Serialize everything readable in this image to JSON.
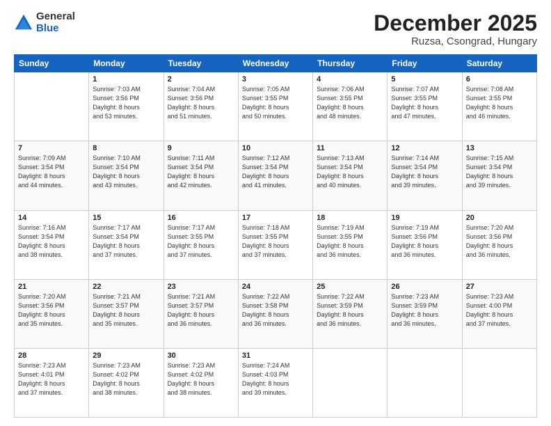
{
  "header": {
    "logo_general": "General",
    "logo_blue": "Blue",
    "title": "December 2025",
    "location": "Ruzsa, Csongrad, Hungary"
  },
  "weekdays": [
    "Sunday",
    "Monday",
    "Tuesday",
    "Wednesday",
    "Thursday",
    "Friday",
    "Saturday"
  ],
  "weeks": [
    [
      {
        "day": "",
        "info": ""
      },
      {
        "day": "1",
        "info": "Sunrise: 7:03 AM\nSunset: 3:56 PM\nDaylight: 8 hours\nand 53 minutes."
      },
      {
        "day": "2",
        "info": "Sunrise: 7:04 AM\nSunset: 3:56 PM\nDaylight: 8 hours\nand 51 minutes."
      },
      {
        "day": "3",
        "info": "Sunrise: 7:05 AM\nSunset: 3:55 PM\nDaylight: 8 hours\nand 50 minutes."
      },
      {
        "day": "4",
        "info": "Sunrise: 7:06 AM\nSunset: 3:55 PM\nDaylight: 8 hours\nand 48 minutes."
      },
      {
        "day": "5",
        "info": "Sunrise: 7:07 AM\nSunset: 3:55 PM\nDaylight: 8 hours\nand 47 minutes."
      },
      {
        "day": "6",
        "info": "Sunrise: 7:08 AM\nSunset: 3:55 PM\nDaylight: 8 hours\nand 46 minutes."
      }
    ],
    [
      {
        "day": "7",
        "info": "Sunrise: 7:09 AM\nSunset: 3:54 PM\nDaylight: 8 hours\nand 44 minutes."
      },
      {
        "day": "8",
        "info": "Sunrise: 7:10 AM\nSunset: 3:54 PM\nDaylight: 8 hours\nand 43 minutes."
      },
      {
        "day": "9",
        "info": "Sunrise: 7:11 AM\nSunset: 3:54 PM\nDaylight: 8 hours\nand 42 minutes."
      },
      {
        "day": "10",
        "info": "Sunrise: 7:12 AM\nSunset: 3:54 PM\nDaylight: 8 hours\nand 41 minutes."
      },
      {
        "day": "11",
        "info": "Sunrise: 7:13 AM\nSunset: 3:54 PM\nDaylight: 8 hours\nand 40 minutes."
      },
      {
        "day": "12",
        "info": "Sunrise: 7:14 AM\nSunset: 3:54 PM\nDaylight: 8 hours\nand 39 minutes."
      },
      {
        "day": "13",
        "info": "Sunrise: 7:15 AM\nSunset: 3:54 PM\nDaylight: 8 hours\nand 39 minutes."
      }
    ],
    [
      {
        "day": "14",
        "info": "Sunrise: 7:16 AM\nSunset: 3:54 PM\nDaylight: 8 hours\nand 38 minutes."
      },
      {
        "day": "15",
        "info": "Sunrise: 7:17 AM\nSunset: 3:54 PM\nDaylight: 8 hours\nand 37 minutes."
      },
      {
        "day": "16",
        "info": "Sunrise: 7:17 AM\nSunset: 3:55 PM\nDaylight: 8 hours\nand 37 minutes."
      },
      {
        "day": "17",
        "info": "Sunrise: 7:18 AM\nSunset: 3:55 PM\nDaylight: 8 hours\nand 37 minutes."
      },
      {
        "day": "18",
        "info": "Sunrise: 7:19 AM\nSunset: 3:55 PM\nDaylight: 8 hours\nand 36 minutes."
      },
      {
        "day": "19",
        "info": "Sunrise: 7:19 AM\nSunset: 3:56 PM\nDaylight: 8 hours\nand 36 minutes."
      },
      {
        "day": "20",
        "info": "Sunrise: 7:20 AM\nSunset: 3:56 PM\nDaylight: 8 hours\nand 36 minutes."
      }
    ],
    [
      {
        "day": "21",
        "info": "Sunrise: 7:20 AM\nSunset: 3:56 PM\nDaylight: 8 hours\nand 35 minutes."
      },
      {
        "day": "22",
        "info": "Sunrise: 7:21 AM\nSunset: 3:57 PM\nDaylight: 8 hours\nand 35 minutes."
      },
      {
        "day": "23",
        "info": "Sunrise: 7:21 AM\nSunset: 3:57 PM\nDaylight: 8 hours\nand 36 minutes."
      },
      {
        "day": "24",
        "info": "Sunrise: 7:22 AM\nSunset: 3:58 PM\nDaylight: 8 hours\nand 36 minutes."
      },
      {
        "day": "25",
        "info": "Sunrise: 7:22 AM\nSunset: 3:59 PM\nDaylight: 8 hours\nand 36 minutes."
      },
      {
        "day": "26",
        "info": "Sunrise: 7:23 AM\nSunset: 3:59 PM\nDaylight: 8 hours\nand 36 minutes."
      },
      {
        "day": "27",
        "info": "Sunrise: 7:23 AM\nSunset: 4:00 PM\nDaylight: 8 hours\nand 37 minutes."
      }
    ],
    [
      {
        "day": "28",
        "info": "Sunrise: 7:23 AM\nSunset: 4:01 PM\nDaylight: 8 hours\nand 37 minutes."
      },
      {
        "day": "29",
        "info": "Sunrise: 7:23 AM\nSunset: 4:02 PM\nDaylight: 8 hours\nand 38 minutes."
      },
      {
        "day": "30",
        "info": "Sunrise: 7:23 AM\nSunset: 4:02 PM\nDaylight: 8 hours\nand 38 minutes."
      },
      {
        "day": "31",
        "info": "Sunrise: 7:24 AM\nSunset: 4:03 PM\nDaylight: 8 hours\nand 39 minutes."
      },
      {
        "day": "",
        "info": ""
      },
      {
        "day": "",
        "info": ""
      },
      {
        "day": "",
        "info": ""
      }
    ]
  ]
}
